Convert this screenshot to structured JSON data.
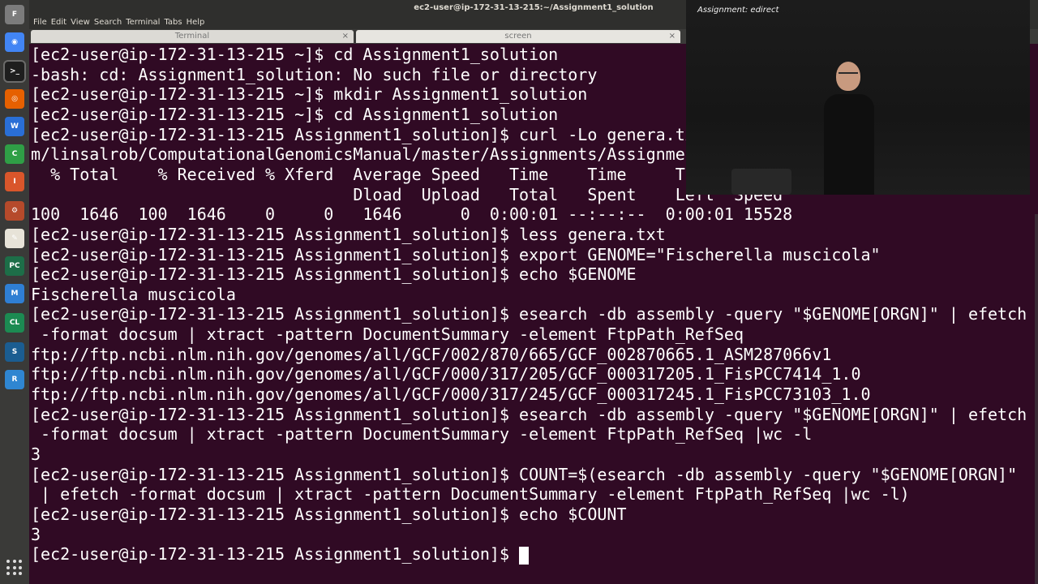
{
  "window": {
    "title": "ec2-user@ip-172-31-13-215:~/Assignment1_solution"
  },
  "menu": [
    "File",
    "Edit",
    "View",
    "Search",
    "Terminal",
    "Tabs",
    "Help"
  ],
  "tabs": [
    {
      "label": "Terminal",
      "active": false
    },
    {
      "label": "screen",
      "active": true
    }
  ],
  "launcher": [
    {
      "name": "files-icon",
      "color": "#7c7c7c",
      "glyph": "F"
    },
    {
      "name": "chrome-icon",
      "color": "#4285f4",
      "glyph": "◉"
    },
    {
      "name": "terminal-icon",
      "color": "#1e1e1e",
      "glyph": ">_"
    },
    {
      "name": "firefox-icon",
      "color": "#e66000",
      "glyph": "◎"
    },
    {
      "name": "writer-icon",
      "color": "#2a6fd6",
      "glyph": "W"
    },
    {
      "name": "calc-icon",
      "color": "#2f9f46",
      "glyph": "C"
    },
    {
      "name": "impress-icon",
      "color": "#d9562b",
      "glyph": "I"
    },
    {
      "name": "settings-icon",
      "color": "#b64a2b",
      "glyph": "⚙"
    },
    {
      "name": "editor-icon",
      "color": "#e7e3d8",
      "glyph": "✎"
    },
    {
      "name": "pycharm-icon",
      "color": "#1d6e48",
      "glyph": "PC"
    },
    {
      "name": "chart-icon",
      "color": "#2f7fd3",
      "glyph": "M"
    },
    {
      "name": "clion-icon",
      "color": "#1c8b52",
      "glyph": "CL"
    },
    {
      "name": "sublime-icon",
      "color": "#1b5d91",
      "glyph": "S"
    },
    {
      "name": "rstudio-icon",
      "color": "#2f86d1",
      "glyph": "R"
    }
  ],
  "webcam": {
    "board_text": "Assignment: edirect"
  },
  "terminal": {
    "lines": [
      "[ec2-user@ip-172-31-13-215 ~]$ cd Assignment1_solution",
      "-bash: cd: Assignment1_solution: No such file or directory",
      "[ec2-user@ip-172-31-13-215 ~]$ mkdir Assignment1_solution",
      "[ec2-user@ip-172-31-13-215 ~]$ cd Assignment1_solution",
      "[ec2-user@ip-172-31-13-215 Assignment1_solution]$ curl -Lo genera.tx",
      "m/linsalrob/ComputationalGenomicsManual/master/Assignments/Assignmen",
      "  % Total    % Received % Xferd  Average Speed   Time    Time     T",
      "                                 Dload  Upload   Total   Spent    Left  Speed",
      "100  1646  100  1646    0     0   1646      0  0:00:01 --:--:--  0:00:01 15528",
      "[ec2-user@ip-172-31-13-215 Assignment1_solution]$ less genera.txt",
      "[ec2-user@ip-172-31-13-215 Assignment1_solution]$ export GENOME=\"Fischerella muscicola\"",
      "[ec2-user@ip-172-31-13-215 Assignment1_solution]$ echo $GENOME",
      "Fischerella muscicola",
      "[ec2-user@ip-172-31-13-215 Assignment1_solution]$ esearch -db assembly -query \"$GENOME[ORGN]\" | efetch",
      " -format docsum | xtract -pattern DocumentSummary -element FtpPath_RefSeq",
      "ftp://ftp.ncbi.nlm.nih.gov/genomes/all/GCF/002/870/665/GCF_002870665.1_ASM287066v1",
      "ftp://ftp.ncbi.nlm.nih.gov/genomes/all/GCF/000/317/205/GCF_000317205.1_FisPCC7414_1.0",
      "ftp://ftp.ncbi.nlm.nih.gov/genomes/all/GCF/000/317/245/GCF_000317245.1_FisPCC73103_1.0",
      "[ec2-user@ip-172-31-13-215 Assignment1_solution]$ esearch -db assembly -query \"$GENOME[ORGN]\" | efetch",
      " -format docsum | xtract -pattern DocumentSummary -element FtpPath_RefSeq |wc -l",
      "3",
      "[ec2-user@ip-172-31-13-215 Assignment1_solution]$ COUNT=$(esearch -db assembly -query \"$GENOME[ORGN]\"",
      " | efetch -format docsum | xtract -pattern DocumentSummary -element FtpPath_RefSeq |wc -l)",
      "[ec2-user@ip-172-31-13-215 Assignment1_solution]$ echo $COUNT",
      "3",
      "[ec2-user@ip-172-31-13-215 Assignment1_solution]$ "
    ]
  }
}
